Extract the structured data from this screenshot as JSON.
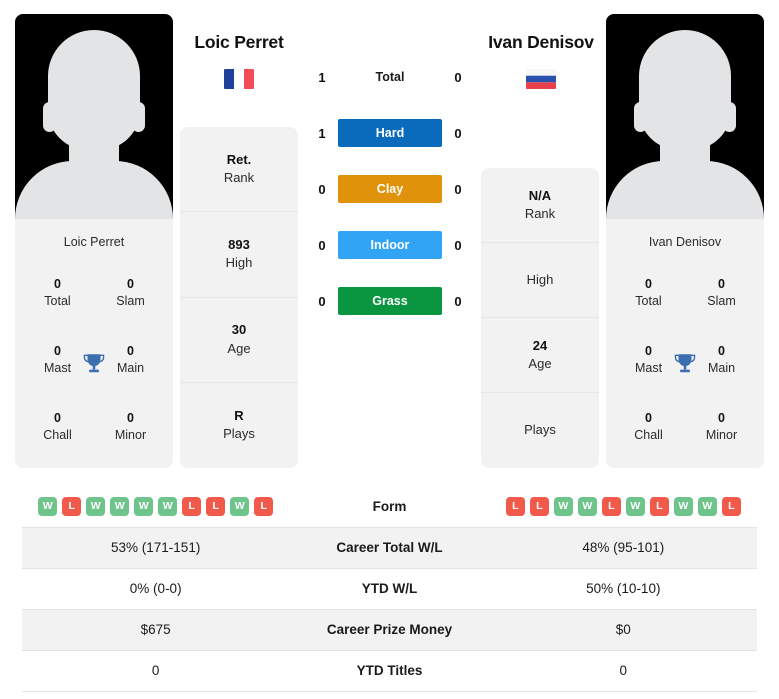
{
  "players": {
    "left": {
      "name": "Loic Perret",
      "card_name": "Loic Perret",
      "flag": "france-flag",
      "titles": [
        {
          "num": "0",
          "label": "Total"
        },
        {
          "num": "0",
          "label": "Slam"
        },
        {
          "num": "0",
          "label": "Mast"
        },
        {
          "num": "0",
          "label": "Main"
        },
        {
          "num": "0",
          "label": "Chall"
        },
        {
          "num": "0",
          "label": "Minor"
        }
      ],
      "info": [
        {
          "value": "Ret.",
          "label": "Rank"
        },
        {
          "value": "893",
          "label": "High"
        },
        {
          "value": "30",
          "label": "Age"
        },
        {
          "value": "R",
          "label": "Plays"
        }
      ],
      "form": [
        "W",
        "L",
        "W",
        "W",
        "W",
        "W",
        "L",
        "L",
        "W",
        "L"
      ],
      "career_wl": "53% (171-151)",
      "ytd_wl": "0% (0-0)",
      "prize_money": "$675",
      "ytd_titles": "0"
    },
    "right": {
      "name": "Ivan Denisov",
      "card_name": "Ivan Denisov",
      "flag": "russia-flag",
      "titles": [
        {
          "num": "0",
          "label": "Total"
        },
        {
          "num": "0",
          "label": "Slam"
        },
        {
          "num": "0",
          "label": "Mast"
        },
        {
          "num": "0",
          "label": "Main"
        },
        {
          "num": "0",
          "label": "Chall"
        },
        {
          "num": "0",
          "label": "Minor"
        }
      ],
      "info": [
        {
          "value": "N/A",
          "label": "Rank"
        },
        {
          "value": "",
          "label": "High"
        },
        {
          "value": "24",
          "label": "Age"
        },
        {
          "value": "",
          "label": "Plays"
        }
      ],
      "form": [
        "L",
        "L",
        "W",
        "W",
        "L",
        "W",
        "L",
        "W",
        "W",
        "L"
      ],
      "career_wl": "48% (95-101)",
      "ytd_wl": "50% (10-10)",
      "prize_money": "$0",
      "ytd_titles": "0"
    }
  },
  "head_to_head": [
    {
      "label": "Total",
      "left": "1",
      "right": "0",
      "badge": false,
      "color": ""
    },
    {
      "label": "Hard",
      "left": "1",
      "right": "0",
      "badge": true,
      "color": "#0a6bbd"
    },
    {
      "label": "Clay",
      "left": "0",
      "right": "0",
      "badge": true,
      "color": "#e0920a"
    },
    {
      "label": "Indoor",
      "left": "0",
      "right": "0",
      "badge": true,
      "color": "#32a4f5"
    },
    {
      "label": "Grass",
      "left": "0",
      "right": "0",
      "badge": true,
      "color": "#0a9641"
    }
  ],
  "stats_rows": [
    {
      "label": "Form",
      "type": "form"
    },
    {
      "label": "Career Total W/L",
      "type": "text",
      "key": "career_wl"
    },
    {
      "label": "YTD W/L",
      "type": "text",
      "key": "ytd_wl"
    },
    {
      "label": "Career Prize Money",
      "type": "text",
      "key": "prize_money"
    },
    {
      "label": "YTD Titles",
      "type": "text",
      "key": "ytd_titles"
    }
  ],
  "colors": {
    "win": "#6ec48a",
    "loss": "#f1594a",
    "trophy": "#3b6fb0",
    "card_bg": "#f2f2f2"
  }
}
